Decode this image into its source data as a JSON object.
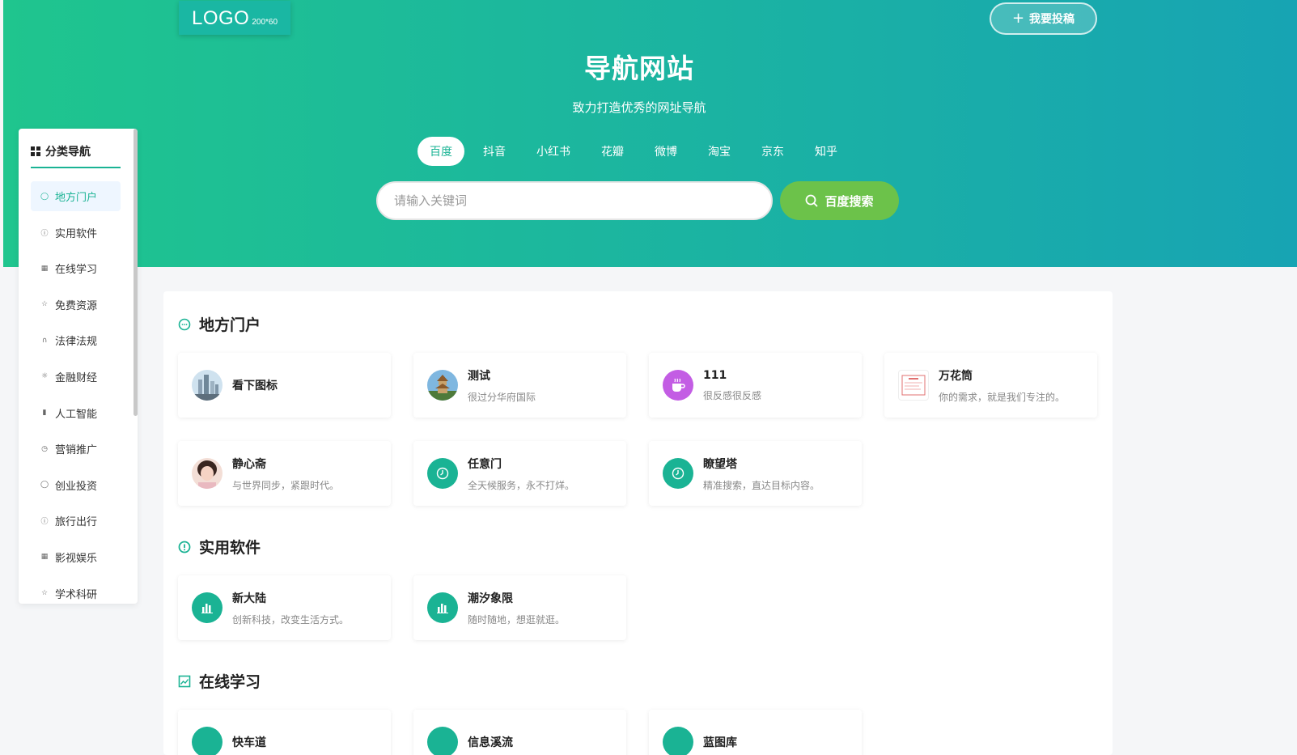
{
  "header": {
    "logo_text": "LOGO",
    "logo_size": "200*60",
    "submit_label": "我要投稿",
    "title": "导航网站",
    "subtitle": "致力打造优秀的网址导航",
    "engine_tabs": [
      "百度",
      "抖音",
      "小红书",
      "花瓣",
      "微博",
      "淘宝",
      "京东",
      "知乎"
    ],
    "active_engine": "百度",
    "search_placeholder": "请输入关键词",
    "search_button_label": "百度搜索"
  },
  "sidebar": {
    "title": "分类导航",
    "items": [
      {
        "label": "地方门户",
        "icon": "chat-icon",
        "active": true
      },
      {
        "label": "实用软件",
        "icon": "alert-circle-icon"
      },
      {
        "label": "在线学习",
        "icon": "image-icon"
      },
      {
        "label": "免费资源",
        "icon": "star-icon"
      },
      {
        "label": "法律法规",
        "icon": "headphones-icon"
      },
      {
        "label": "金融财经",
        "icon": "sun-icon"
      },
      {
        "label": "人工智能",
        "icon": "bar-chart-icon"
      },
      {
        "label": "营销推广",
        "icon": "clock-icon"
      },
      {
        "label": "创业投资",
        "icon": "chat-icon"
      },
      {
        "label": "旅行出行",
        "icon": "alert-circle-icon"
      },
      {
        "label": "影视娱乐",
        "icon": "image-icon"
      },
      {
        "label": "学术科研",
        "icon": "star-icon"
      }
    ]
  },
  "sections": [
    {
      "title": "地方门户",
      "icon": "chat-icon",
      "cards": [
        {
          "title": "看下图标",
          "desc": "",
          "icon": "city-photo"
        },
        {
          "title": "测试",
          "desc": "很过分华府国际",
          "icon": "pagoda-photo"
        },
        {
          "title": "111",
          "desc": "很反感很反感",
          "icon": "coffee-cup-icon"
        },
        {
          "title": "万花筒",
          "desc": "你的需求，就是我们专注的。",
          "icon": "document-thumb"
        },
        {
          "title": "静心斋",
          "desc": "与世界同步，紧跟时代。",
          "icon": "portrait-photo"
        },
        {
          "title": "任意门",
          "desc": "全天候服务，永不打烊。",
          "icon": "clock-icon"
        },
        {
          "title": "瞭望塔",
          "desc": "精准搜索，直达目标内容。",
          "icon": "clock-icon"
        }
      ]
    },
    {
      "title": "实用软件",
      "icon": "alert-circle-icon",
      "cards": [
        {
          "title": "新大陆",
          "desc": "创新科技，改变生活方式。",
          "icon": "bar-chart-icon"
        },
        {
          "title": "潮汐象限",
          "desc": "随时随地，想逛就逛。",
          "icon": "bar-chart-icon"
        }
      ]
    },
    {
      "title": "在线学习",
      "icon": "image-icon",
      "cards": [
        {
          "title": "快车道",
          "desc": "",
          "icon": "teal-circle"
        },
        {
          "title": "信息溪流",
          "desc": "",
          "icon": "teal-circle"
        },
        {
          "title": "蓝图库",
          "desc": "",
          "icon": "teal-circle"
        }
      ]
    }
  ]
}
